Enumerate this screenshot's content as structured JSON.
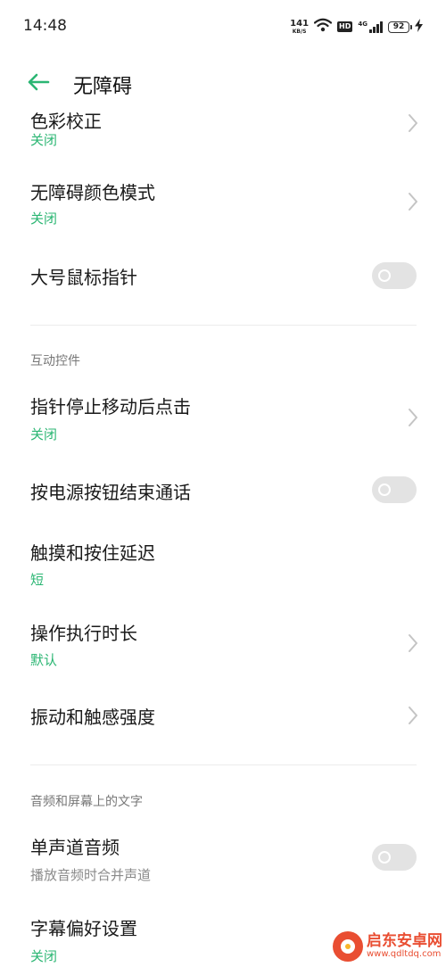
{
  "status_bar": {
    "time": "14:48",
    "net_speed_value": "141",
    "net_speed_unit": "KB/S",
    "hd_label": "HD",
    "network_type": "4G",
    "battery_level": "92",
    "icons": [
      "wifi-icon",
      "signal-icon",
      "battery-icon",
      "charging-icon"
    ]
  },
  "header": {
    "title": "无障碍",
    "back_icon": "arrow-left-icon"
  },
  "colors": {
    "accent": "#2bb673",
    "toggle_off": "#e3e3e3",
    "section_header": "#777777",
    "watermark": "#e94e32"
  },
  "items": [
    {
      "title": "色彩校正",
      "subtitle": "关闭",
      "control": "chevron"
    },
    {
      "title": "无障碍颜色模式",
      "subtitle": "关闭",
      "control": "chevron"
    },
    {
      "title": "大号鼠标指针",
      "control": "toggle",
      "toggle_on": false
    }
  ],
  "sections": [
    {
      "header": "互动控件",
      "items": [
        {
          "title": "指针停止移动后点击",
          "subtitle": "关闭",
          "control": "chevron"
        },
        {
          "title": "按电源按钮结束通话",
          "control": "toggle",
          "toggle_on": false
        },
        {
          "title": "触摸和按住延迟",
          "subtitle": "短",
          "control": "none"
        },
        {
          "title": "操作执行时长",
          "subtitle": "默认",
          "control": "chevron"
        },
        {
          "title": "振动和触感强度",
          "control": "chevron"
        }
      ]
    },
    {
      "header": "音频和屏幕上的文字",
      "items": [
        {
          "title": "单声道音频",
          "subtitle": "播放音频时合并声道",
          "control": "toggle",
          "toggle_on": false
        },
        {
          "title": "字幕偏好设置",
          "subtitle": "关闭",
          "control": "chevron"
        }
      ]
    }
  ],
  "watermark": {
    "name": "启东安卓网",
    "url": "www.qdltdq.com"
  }
}
